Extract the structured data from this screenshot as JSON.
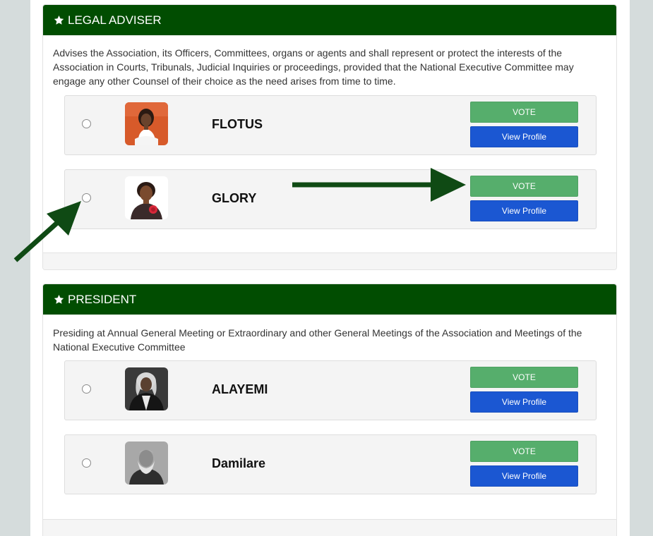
{
  "sections": [
    {
      "title": "LEGAL ADVISER",
      "description": "Advises the Association, its Officers, Committees, organs or agents and shall represent or protect the interests of the Association in Courts, Tribunals, Judicial Inquiries or proceedings, provided that the National Executive Committee may engage any other Counsel of their choice as the need arises from time to time.",
      "candidates": [
        {
          "name": "FLOTUS",
          "vote_label": "VOTE",
          "profile_label": "View Profile"
        },
        {
          "name": "GLORY",
          "vote_label": "VOTE",
          "profile_label": "View Profile"
        }
      ]
    },
    {
      "title": "PRESIDENT",
      "description": "Presiding at Annual General Meeting or Extraordinary and other General Meetings of the Association and Meetings of the National Executive Committee",
      "candidates": [
        {
          "name": "ALAYEMI",
          "vote_label": "VOTE",
          "profile_label": "View Profile"
        },
        {
          "name": "Damilare",
          "vote_label": "VOTE",
          "profile_label": "View Profile"
        }
      ]
    }
  ],
  "colors": {
    "heading_bg": "#014d01",
    "vote_button": "#56ae6c",
    "profile_button": "#1b57d2",
    "annotation_arrow": "#0f4a14"
  },
  "icons": {
    "heading": "star-icon",
    "annotation": "arrow-icon"
  }
}
